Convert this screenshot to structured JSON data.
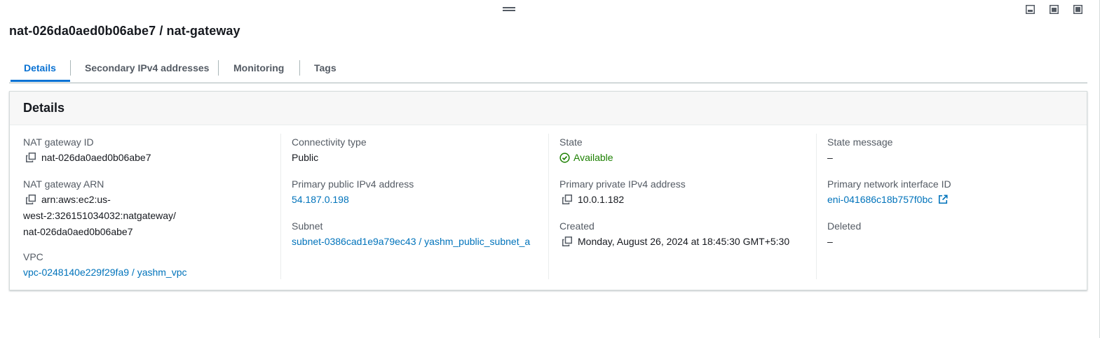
{
  "title": "nat-026da0aed0b06abe7 / nat-gateway",
  "tabs": [
    {
      "label": "Details"
    },
    {
      "label": "Secondary IPv4 addresses"
    },
    {
      "label": "Monitoring"
    },
    {
      "label": "Tags"
    }
  ],
  "panel": {
    "header": "Details",
    "fields": {
      "nat_id": {
        "label": "NAT gateway ID",
        "value": "nat-026da0aed0b06abe7"
      },
      "nat_arn": {
        "label": "NAT gateway ARN",
        "value_line1": "arn:aws:ec2:us-",
        "value_line2": "west-2:326151034032:natgateway/",
        "value_line3": "nat-026da0aed0b06abe7"
      },
      "vpc": {
        "label": "VPC",
        "value": "vpc-0248140e229f29fa9 / yashm_vpc"
      },
      "connectivity": {
        "label": "Connectivity type",
        "value": "Public"
      },
      "public_ip": {
        "label": "Primary public IPv4 address",
        "value": "54.187.0.198"
      },
      "subnet": {
        "label": "Subnet",
        "value": "subnet-0386cad1e9a79ec43 / yashm_public_subnet_a"
      },
      "state": {
        "label": "State",
        "value": "Available"
      },
      "private_ip": {
        "label": "Primary private IPv4 address",
        "value": "10.0.1.182"
      },
      "created": {
        "label": "Created",
        "value": "Monday, August 26, 2024 at 18:45:30 GMT+5:30"
      },
      "state_message": {
        "label": "State message",
        "value": "–"
      },
      "eni": {
        "label": "Primary network interface ID",
        "value": "eni-041686c18b757f0bc"
      },
      "deleted": {
        "label": "Deleted",
        "value": "–"
      }
    }
  },
  "colors": {
    "link": "#0073bb",
    "tab_active": "#0972d3",
    "status_success": "#1d8102",
    "text": "#16191f",
    "label": "#545b64"
  },
  "icons": [
    "drag-handle-icon",
    "view-bottom-icon",
    "view-side-icon",
    "view-full-icon",
    "copy-icon",
    "status-available-icon",
    "external-link-icon"
  ]
}
